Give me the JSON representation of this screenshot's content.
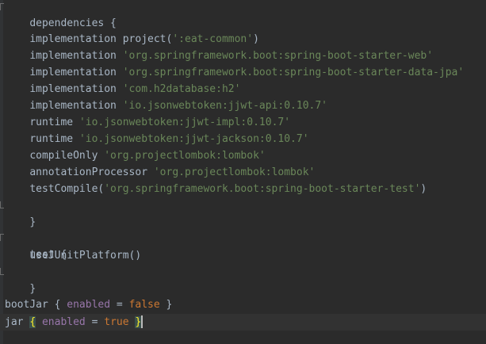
{
  "colors": {
    "background": "#2b2b2b",
    "current_line": "#323232",
    "plain": "#a9b7c6",
    "string": "#6a8759",
    "keyword": "#cc7832",
    "property": "#9876aa",
    "brace_match": "#ffef28"
  },
  "code": {
    "l1": {
      "text": "dependencies {"
    },
    "l3": {
      "kw": "implementation",
      "pre": " project(",
      "str": "':eat-common'",
      "post": ")"
    },
    "l4": {
      "kw": "implementation",
      "str": "'org.springframework.boot:spring-boot-starter-web'"
    },
    "l5": {
      "kw": "implementation",
      "str": "'org.springframework.boot:spring-boot-starter-data-jpa'"
    },
    "l6": {
      "kw": "implementation",
      "str": "'com.h2database:h2'"
    },
    "l7": {
      "kw": "implementation",
      "str": "'io.jsonwebtoken:jjwt-api:0.10.7'"
    },
    "l8": {
      "kw": "runtime",
      "str": "'io.jsonwebtoken:jjwt-impl:0.10.7'"
    },
    "l9": {
      "kw": "runtime",
      "str": "'io.jsonwebtoken:jjwt-jackson:0.10.7'"
    },
    "l10": {
      "kw": "compileOnly",
      "str": "'org.projectlombok:lombok'"
    },
    "l11": {
      "kw": "annotationProcessor",
      "str": "'org.projectlombok:lombok'"
    },
    "l12": {
      "kw": "testCompile(",
      "str": "'org.springframework.boot:spring-boot-starter-test'",
      "post": ")"
    },
    "l13": {
      "text": "}"
    },
    "l15": {
      "text": "test {"
    },
    "l16": {
      "text": "useJUnitPlatform()"
    },
    "l17": {
      "text": "}"
    },
    "l19": {
      "pre": "bootJar { ",
      "prop": "enabled",
      "eq": " = ",
      "val": "false",
      "post": " }"
    },
    "l20": {
      "pre": "jar ",
      "open": "{",
      "prop": "enabled",
      "eq": " = ",
      "val": "true",
      "close": "}"
    }
  }
}
